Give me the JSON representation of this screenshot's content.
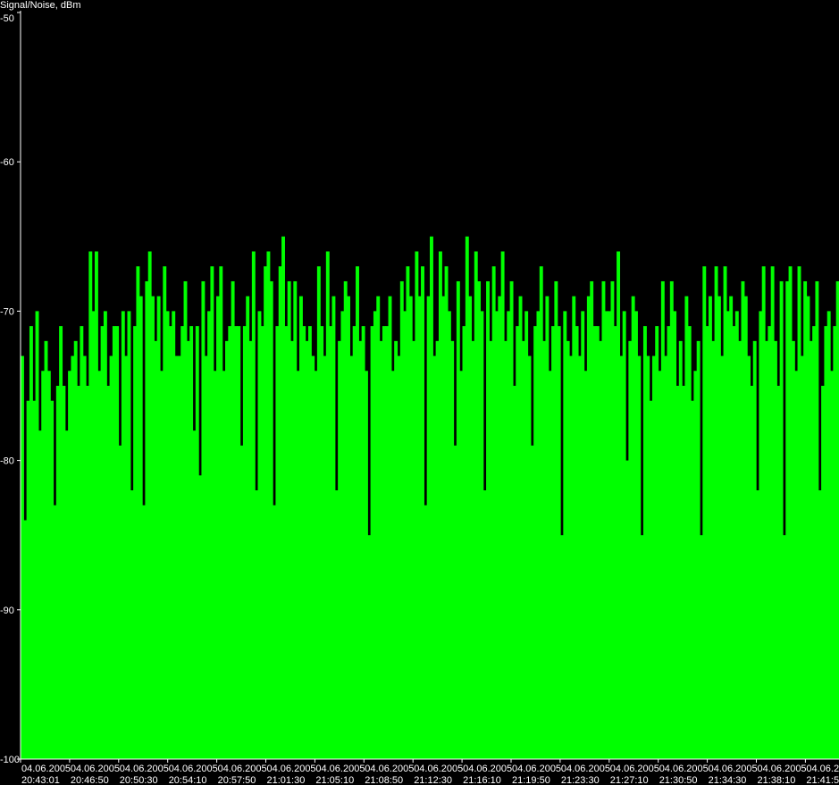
{
  "chart_data": {
    "type": "area",
    "title": "",
    "ylabel": "Signal/Noise, dBm",
    "xlabel": "",
    "ylim": [
      -100,
      -50
    ],
    "ytick_labels": [
      "-50",
      "-60",
      "-70",
      "-80",
      "-90",
      "-100"
    ],
    "yticks": [
      -50,
      -60,
      -70,
      -80,
      -90,
      -100
    ],
    "xtick_labels": [
      {
        "date": "04.06.2005",
        "time": "20:43:01"
      },
      {
        "date": "04.06.2005",
        "time": "20:46:50"
      },
      {
        "date": "04.06.2005",
        "time": "20:50:30"
      },
      {
        "date": "04.06.2005",
        "time": "20:54:10"
      },
      {
        "date": "04.06.2005",
        "time": "20:57:50"
      },
      {
        "date": "04.06.2005",
        "time": "21:01:30"
      },
      {
        "date": "04.06.2005",
        "time": "21:05:10"
      },
      {
        "date": "04.06.2005",
        "time": "21:08:50"
      },
      {
        "date": "04.06.2005",
        "time": "21:12:30"
      },
      {
        "date": "04.06.2005",
        "time": "21:16:10"
      },
      {
        "date": "04.06.2005",
        "time": "21:19:50"
      },
      {
        "date": "04.06.2005",
        "time": "21:23:30"
      },
      {
        "date": "04.06.2005",
        "time": "21:27:10"
      },
      {
        "date": "04.06.2005",
        "time": "21:30:50"
      },
      {
        "date": "04.06.2005",
        "time": "21:34:30"
      },
      {
        "date": "04.06.2005",
        "time": "21:38:10"
      },
      {
        "date": "04.06.2",
        "time": "21:41:5"
      }
    ],
    "series": [
      {
        "color": "#00ff00",
        "values": [
          -73,
          -84,
          -76,
          -71,
          -76,
          -70,
          -78,
          -74,
          -72,
          -74,
          -76,
          -83,
          -75,
          -71,
          -75,
          -78,
          -74,
          -73,
          -72,
          -75,
          -71,
          -73,
          -75,
          -66,
          -70,
          -66,
          -74,
          -71,
          -70,
          -75,
          -73,
          -71,
          -71,
          -79,
          -70,
          -73,
          -70,
          -82,
          -71,
          -67,
          -69,
          -83,
          -68,
          -66,
          -69,
          -72,
          -69,
          -74,
          -67,
          -70,
          -71,
          -70,
          -73,
          -73,
          -71,
          -68,
          -72,
          -71,
          -78,
          -71,
          -81,
          -68,
          -73,
          -70,
          -67,
          -74,
          -69,
          -67,
          -74,
          -72,
          -71,
          -68,
          -71,
          -71,
          -79,
          -71,
          -69,
          -72,
          -66,
          -82,
          -70,
          -71,
          -67,
          -66,
          -68,
          -83,
          -71,
          -67,
          -65,
          -71,
          -68,
          -72,
          -68,
          -74,
          -69,
          -71,
          -72,
          -71,
          -73,
          -74,
          -67,
          -71,
          -73,
          -66,
          -71,
          -69,
          -82,
          -72,
          -70,
          -68,
          -69,
          -73,
          -71,
          -67,
          -72,
          -71,
          -74,
          -85,
          -71,
          -70,
          -69,
          -72,
          -71,
          -71,
          -69,
          -74,
          -72,
          -73,
          -68,
          -70,
          -67,
          -69,
          -72,
          -66,
          -69,
          -67,
          -83,
          -69,
          -65,
          -73,
          -72,
          -66,
          -69,
          -67,
          -70,
          -72,
          -79,
          -68,
          -74,
          -71,
          -65,
          -69,
          -72,
          -66,
          -68,
          -70,
          -82,
          -68,
          -72,
          -67,
          -70,
          -69,
          -66,
          -72,
          -70,
          -68,
          -75,
          -71,
          -69,
          -72,
          -70,
          -73,
          -79,
          -71,
          -70,
          -67,
          -72,
          -69,
          -74,
          -71,
          -68,
          -71,
          -85,
          -70,
          -72,
          -73,
          -69,
          -71,
          -73,
          -70,
          -74,
          -69,
          -68,
          -71,
          -71,
          -72,
          -68,
          -70,
          -70,
          -68,
          -71,
          -66,
          -73,
          -70,
          -80,
          -72,
          -69,
          -70,
          -73,
          -85,
          -71,
          -73,
          -76,
          -73,
          -71,
          -74,
          -68,
          -73,
          -71,
          -68,
          -70,
          -75,
          -72,
          -75,
          -69,
          -71,
          -76,
          -74,
          -72,
          -85,
          -67,
          -71,
          -69,
          -72,
          -67,
          -69,
          -73,
          -67,
          -70,
          -69,
          -71,
          -70,
          -72,
          -68,
          -69,
          -73,
          -75,
          -72,
          -82,
          -70,
          -67,
          -72,
          -71,
          -67,
          -72,
          -75,
          -68,
          -85,
          -68,
          -67,
          -72,
          -74,
          -67,
          -73,
          -68,
          -69,
          -72,
          -71,
          -68,
          -82,
          -75,
          -71,
          -70,
          -74,
          -71,
          -68
        ]
      }
    ]
  }
}
